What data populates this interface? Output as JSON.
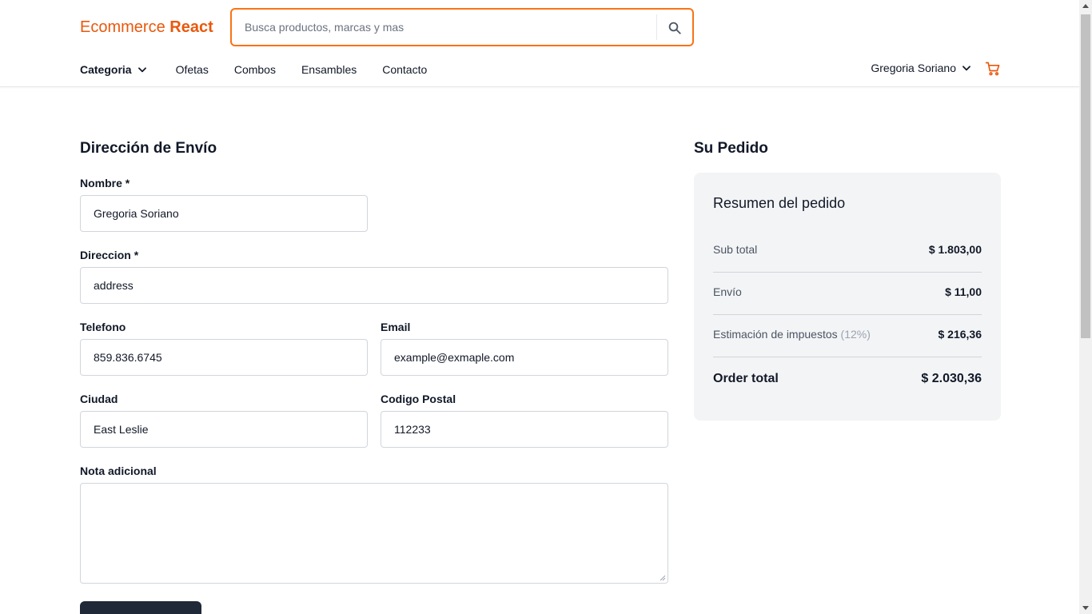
{
  "header": {
    "logo_prefix": "Ecommerce ",
    "logo_bold": "React",
    "search_placeholder": "Busca productos, marcas y mas",
    "nav": {
      "categoria": "Categoria",
      "links": [
        "Ofetas",
        "Combos",
        "Ensambles",
        "Contacto"
      ]
    },
    "user_name": "Gregoria Soriano"
  },
  "shipping": {
    "title": "Dirección de Envío",
    "fields": {
      "nombre": {
        "label": "Nombre *",
        "value": "Gregoria Soriano"
      },
      "direccion": {
        "label": "Direccion *",
        "value": "address"
      },
      "telefono": {
        "label": "Telefono",
        "value": "859.836.6745"
      },
      "email": {
        "label": "Email",
        "value": "example@exmaple.com"
      },
      "ciudad": {
        "label": "Ciudad",
        "value": "East Leslie"
      },
      "codigo_postal": {
        "label": "Codigo Postal",
        "value": "112233"
      },
      "nota": {
        "label": "Nota adicional",
        "value": ""
      }
    }
  },
  "order": {
    "title": "Su Pedido",
    "summary_title": "Resumen del pedido",
    "subtotal_label": "Sub total",
    "subtotal_value": "$ 1.803,00",
    "envio_label": "Envío",
    "envio_value": "$ 11,00",
    "tax_label": "Estimación de impuestos",
    "tax_rate": "(12%)",
    "tax_value": "$ 216,36",
    "total_label": "Order total",
    "total_value": "$ 2.030,36"
  },
  "colors": {
    "accent": "#ea580c",
    "search_border": "#f97316",
    "card_bg": "#f3f4f6",
    "button_dark": "#1f2937"
  },
  "icons": [
    "search-icon",
    "chevron-down-icon",
    "cart-icon"
  ]
}
